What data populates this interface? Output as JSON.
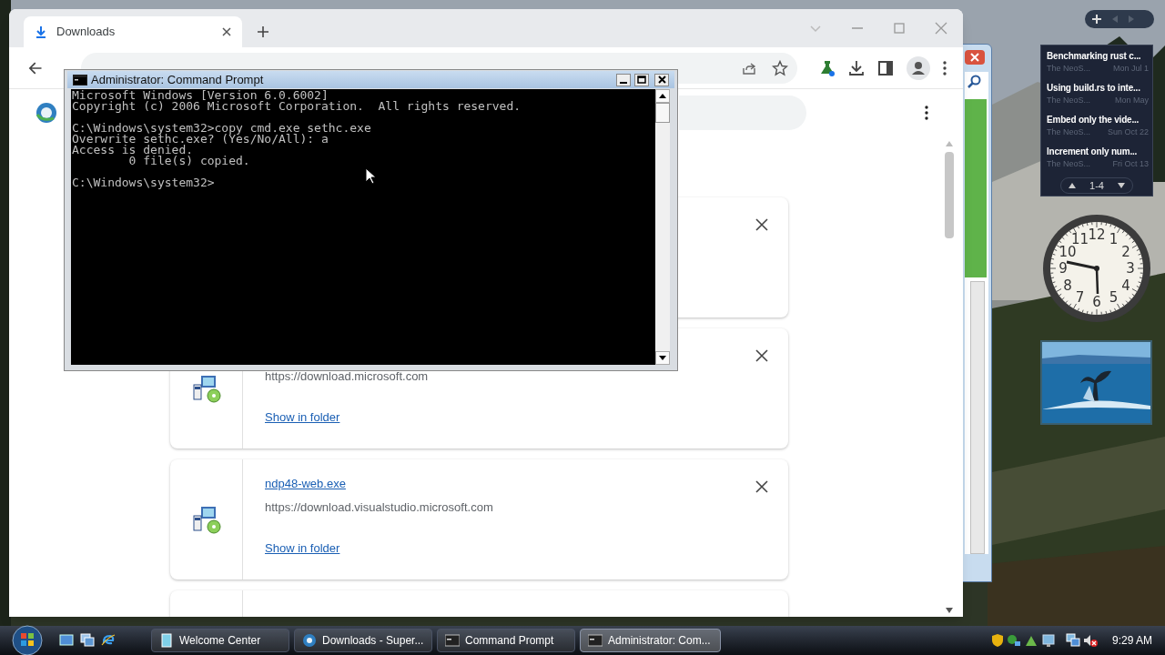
{
  "browser": {
    "tabs": [
      {
        "label": "Downloads",
        "selected": true
      }
    ],
    "downloads": [
      {
        "kind": "covered"
      },
      {
        "url": "https://download.microsoft.com",
        "link": "Show in folder"
      },
      {
        "name": "ndp48-web.exe",
        "url": "https://download.visualstudio.microsoft.com",
        "link": "Show in folder"
      },
      {
        "kind": "covered"
      }
    ]
  },
  "console": {
    "title": "Administrator: Command Prompt",
    "blocks": [
      [
        "Microsoft Windows [Version 6.0.6002]",
        "Copyright (c) 2006 Microsoft Corporation.  All rights reserved."
      ],
      [
        "C:\\Windows\\system32>copy cmd.exe sethc.exe",
        "Overwrite sethc.exe? (Yes/No/All): a",
        "Access is denied.",
        "        0 file(s) copied."
      ],
      [
        "C:\\Windows\\system32>"
      ]
    ]
  },
  "feed": {
    "items": [
      {
        "title": "Benchmarking rust c...",
        "source": "The NeoS...",
        "date": "Mon Jul 1"
      },
      {
        "title": "Using build.rs to inte...",
        "source": "The NeoS...",
        "date": "Mon May"
      },
      {
        "title": "Embed only the vide...",
        "source": "The NeoS...",
        "date": "Sun Oct 22"
      },
      {
        "title": "Increment only num...",
        "source": "The NeoS...",
        "date": "Fri Oct 13"
      }
    ],
    "pager": "1-4"
  },
  "clock": {
    "numerals": [
      "12",
      "11",
      "1",
      "10",
      "2",
      "9",
      "3",
      "8",
      "4",
      "7",
      "5",
      "6"
    ]
  },
  "taskbar": {
    "buttons": [
      {
        "label": "Welcome Center",
        "kind": "welcome",
        "selected": false
      },
      {
        "label": "Downloads - Super...",
        "kind": "browser",
        "selected": false
      },
      {
        "label": "Command Prompt",
        "kind": "console",
        "selected": false
      },
      {
        "label": "Administrator: Com...",
        "kind": "console",
        "selected": true
      }
    ],
    "time": "9:29 AM"
  }
}
